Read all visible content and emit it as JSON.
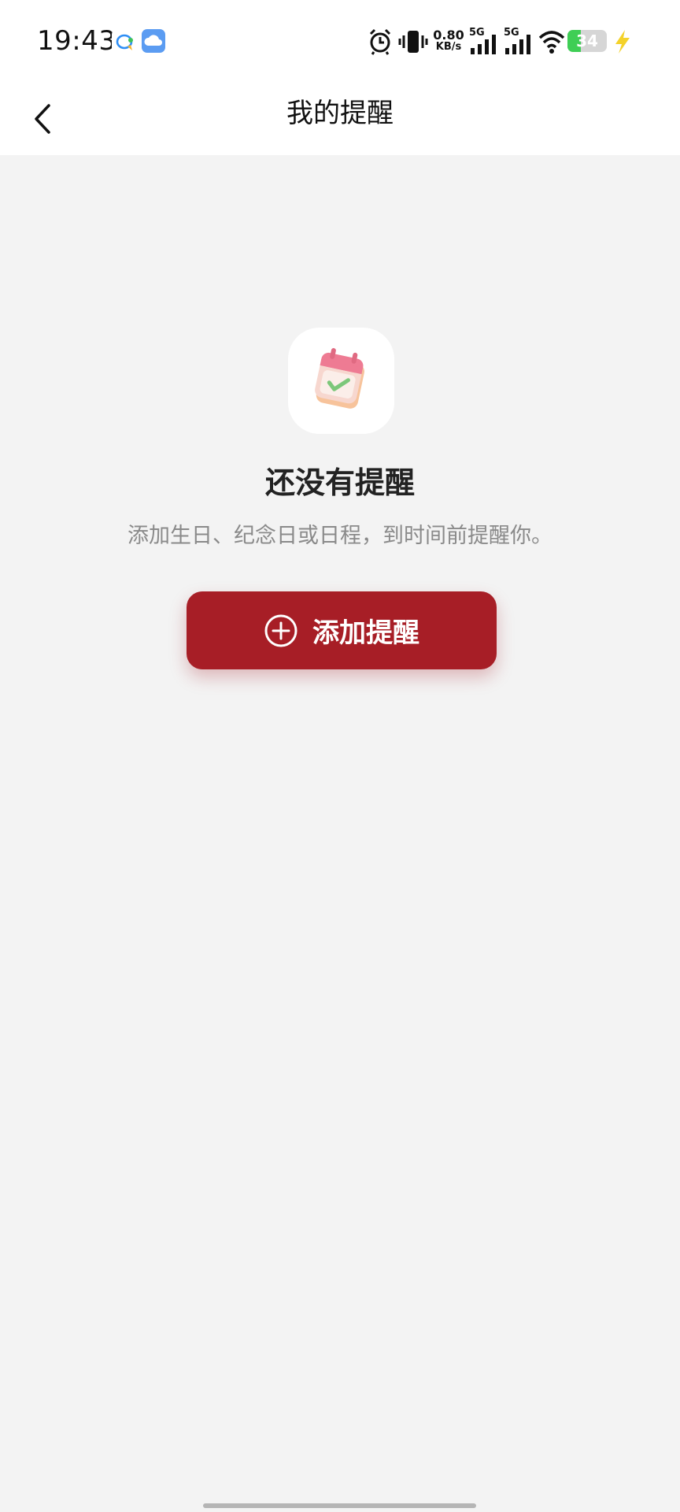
{
  "status_bar": {
    "time": "19:43",
    "notifications": [
      "chat-bubble-icon",
      "weather-cloud-icon"
    ],
    "network_speed_value": "0.80",
    "network_speed_unit": "KB/s",
    "signal_1_label": "5G",
    "signal_2_label": "5G",
    "battery_level": "34",
    "icons": [
      "alarm-icon",
      "vibrate-icon",
      "signal-icon",
      "wifi-icon",
      "battery-icon",
      "charging-icon"
    ]
  },
  "header": {
    "title": "我的提醒",
    "back_icon": "chevron-left-icon"
  },
  "empty_state": {
    "icon": "calendar-check-icon",
    "title": "还没有提醒",
    "subtitle": "添加生日、纪念日或日程，到时间前提醒你。"
  },
  "actions": {
    "add_button_label": "添加提醒",
    "add_button_icon": "plus-circle-icon"
  },
  "colors": {
    "accent": "#a71e26",
    "background": "#f3f3f3",
    "battery_green": "#3fce55"
  }
}
